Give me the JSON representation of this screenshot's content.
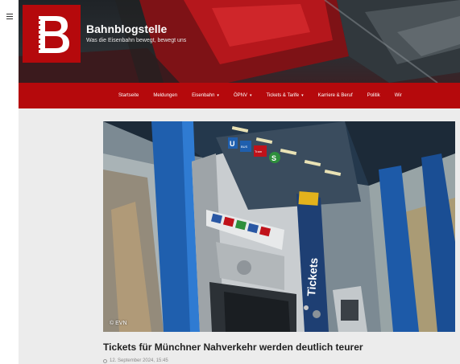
{
  "header": {
    "title": "Bahnblogstelle",
    "tagline": "Was die Eisenbahn bewegt, bewegt uns",
    "logo_letter": "B",
    "logo_color": "#b5090c"
  },
  "nav": {
    "items": [
      {
        "label": "Startseite",
        "dropdown": false
      },
      {
        "label": "Meldungen",
        "dropdown": false
      },
      {
        "label": "Eisenbahn",
        "dropdown": true
      },
      {
        "label": "ÖPNV",
        "dropdown": true
      },
      {
        "label": "Tickets & Tarife",
        "dropdown": true
      },
      {
        "label": "Karriere & Beruf",
        "dropdown": false
      },
      {
        "label": "Politik",
        "dropdown": false
      },
      {
        "label": "Wir",
        "dropdown": false
      }
    ],
    "caret": "▾",
    "bar_color": "#b5090c"
  },
  "article": {
    "image_credit": "© EVN",
    "machine_label": "Tickets",
    "sign_letters": [
      "U",
      "BUS",
      "Tram",
      "S"
    ],
    "headline": "Tickets für Münchner Nahverkehr werden deutlich teurer",
    "date": "12. September 2024, 15:45"
  },
  "icons": {
    "menu": "hamburger-menu-icon",
    "date": "clock-icon"
  }
}
